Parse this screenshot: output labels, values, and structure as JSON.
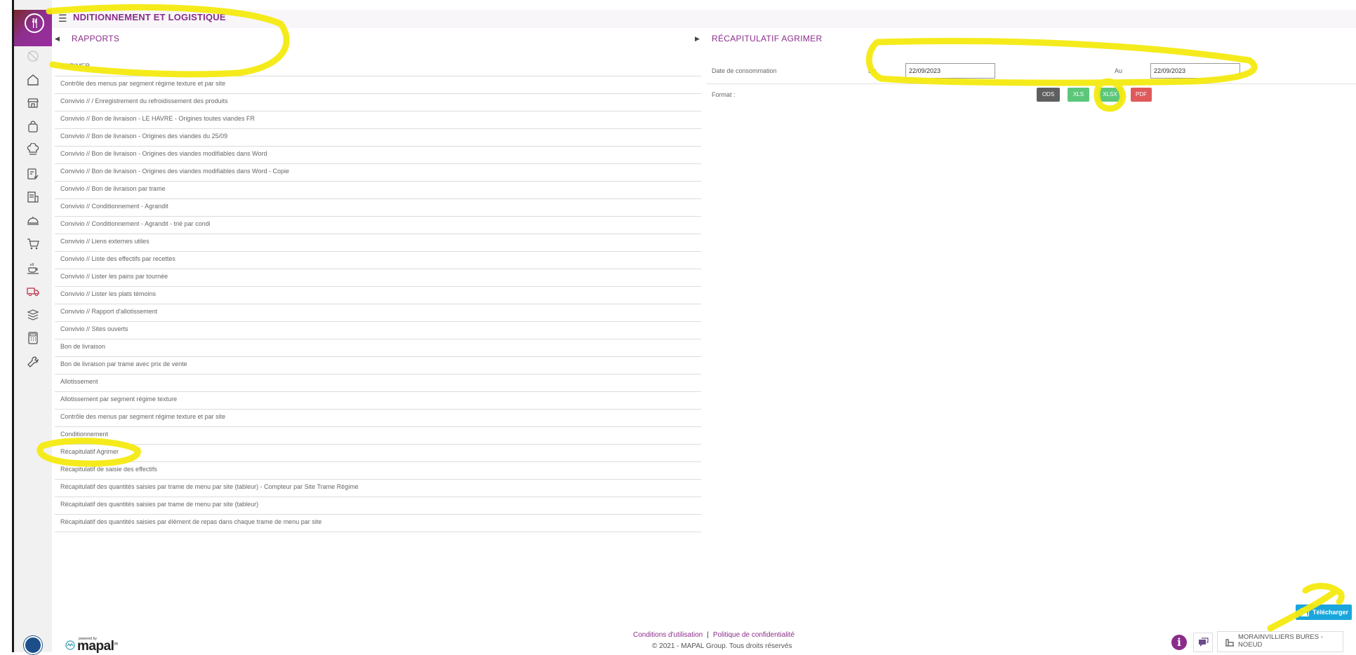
{
  "header": {
    "title": "NDITIONNEMENT ET LOGISTIQUE",
    "menu_icon": "hamburger-icon"
  },
  "sidebar": {
    "logo_icon": "fork-knife-logo-icon",
    "items": [
      {
        "icon": "disabled-plate-icon"
      },
      {
        "icon": "home-icon"
      },
      {
        "icon": "store-icon"
      },
      {
        "icon": "bag-icon"
      },
      {
        "icon": "chef-hat-icon"
      },
      {
        "icon": "recipe-card-icon"
      },
      {
        "icon": "document-building-icon"
      },
      {
        "icon": "cloche-icon"
      },
      {
        "icon": "cart-icon"
      },
      {
        "icon": "hot-drink-icon"
      },
      {
        "icon": "delivery-truck-icon",
        "active": true
      },
      {
        "icon": "box-stack-icon"
      },
      {
        "icon": "calculator-icon"
      },
      {
        "icon": "wrench-icon"
      }
    ]
  },
  "reports_panel": {
    "title": "RAPPORTS",
    "items": [
      "AGRIMER",
      "Contrôle des menus par segment régime texture et par site",
      "Convivio // / Enregistrement du refroidissement des produits",
      "Convivio // Bon de livraison - LE HAVRE - Origines toutes viandes FR",
      "Convivio // Bon de livraison - Origines des viandes du 25/09",
      "Convivio // Bon de livraison - Origines des viandes modifiables dans Word",
      "Convivio // Bon de livraison - Origines des viandes modifiables dans Word - Copie",
      "Convivio // Bon de livraison par trame",
      "Convivio // Conditionnement - Agrandit",
      "Convivio // Conditionnement - Agrandit - trié par condi",
      "Convivio // Liens externes utiles",
      "Convivio // Liste des effectifs par recettes",
      "Convivio // Lister les pains par tournée",
      "Convivio // Lister les plats témoins",
      "Convivio // Rapport d'allotissement",
      "Convivio // Sites ouverts",
      "Bon de livraison",
      "Bon de livraison par trame avec prix de vente",
      "Allotissement",
      "Allotissement par segment régime texture",
      "Contrôle des menus par segment régime texture et par site",
      "Conditionnement",
      "Récapitulatif Agrimer",
      "Récapitulatif de saisie des effectifs",
      "Récapitulatif des quantités saisies par trame de menu par site (tableur) - Compteur par Site Trame Régime",
      "Récapitulatif des quantités saisies par trame de menu par site (tableur)",
      "Récapitulatif des quantités saisies par élément de repas dans chaque trame de menu par site"
    ]
  },
  "detail_panel": {
    "title": "RÉCAPITULATIF AGRIMER",
    "date_label": "Date de consommation",
    "from_label": "Du",
    "from_value": "22/09/2023",
    "to_label": "Au",
    "to_value": "22/09/2023",
    "format_label": "Format :",
    "formats": [
      {
        "label": "ODS",
        "color": "#5f5f5f"
      },
      {
        "label": "XLS",
        "color": "#5cc77a"
      },
      {
        "label": "XLSX",
        "color": "#5cc77a"
      },
      {
        "label": "PDF",
        "color": "#e05a5a"
      }
    ],
    "download_label": "Télécharger"
  },
  "footer": {
    "terms": "Conditions d'utilisation",
    "separator": "|",
    "privacy": "Politique de confidentialité",
    "copyright": "© 2021 - MAPAL Group. Tous droits réservés",
    "powered_by": "powered by",
    "brand": "mapal",
    "brand_sup": "os",
    "site_name": "MORAINVILLIERS BURES - NOEUD"
  }
}
